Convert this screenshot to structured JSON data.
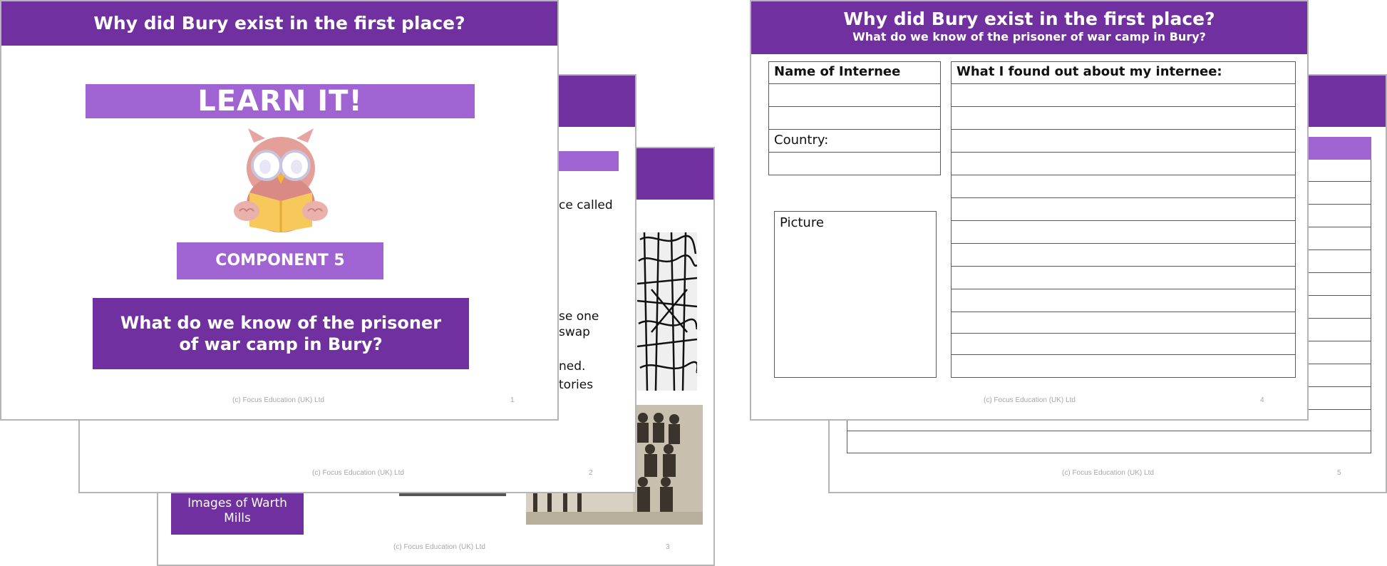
{
  "slide1": {
    "title": "Why did Bury exist in the first place?",
    "banner": "LEARN IT!",
    "component": "COMPONENT 5",
    "question": "What do we know of the prisoner of war camp in Bury?",
    "footer": "(c) Focus Education (UK) Ltd",
    "page": "1"
  },
  "slide2": {
    "text_fragments": [
      "ce called",
      "se one",
      "swap",
      "ned.",
      "tories"
    ],
    "footer": "(c) Focus Education (UK) Ltd",
    "page": "2"
  },
  "slide3": {
    "button": "Images of Warth Mills",
    "footer": "(c) Focus Education (UK) Ltd",
    "page": "3"
  },
  "slide4": {
    "title": "Why did Bury exist in the first place?",
    "subtitle": "What do we know of the prisoner of war camp in Bury?",
    "name_label": "Name of Internee",
    "country_label": "Country:",
    "picture_label": "Picture",
    "found_label": "What I found out about my internee:",
    "footer": "(c) Focus Education (UK) Ltd",
    "page": "4"
  },
  "slide5": {
    "footer": "(c) Focus Education (UK) Ltd",
    "page": "5"
  },
  "colors": {
    "header_purple": "#7030a0",
    "light_purple": "#a064d2"
  }
}
